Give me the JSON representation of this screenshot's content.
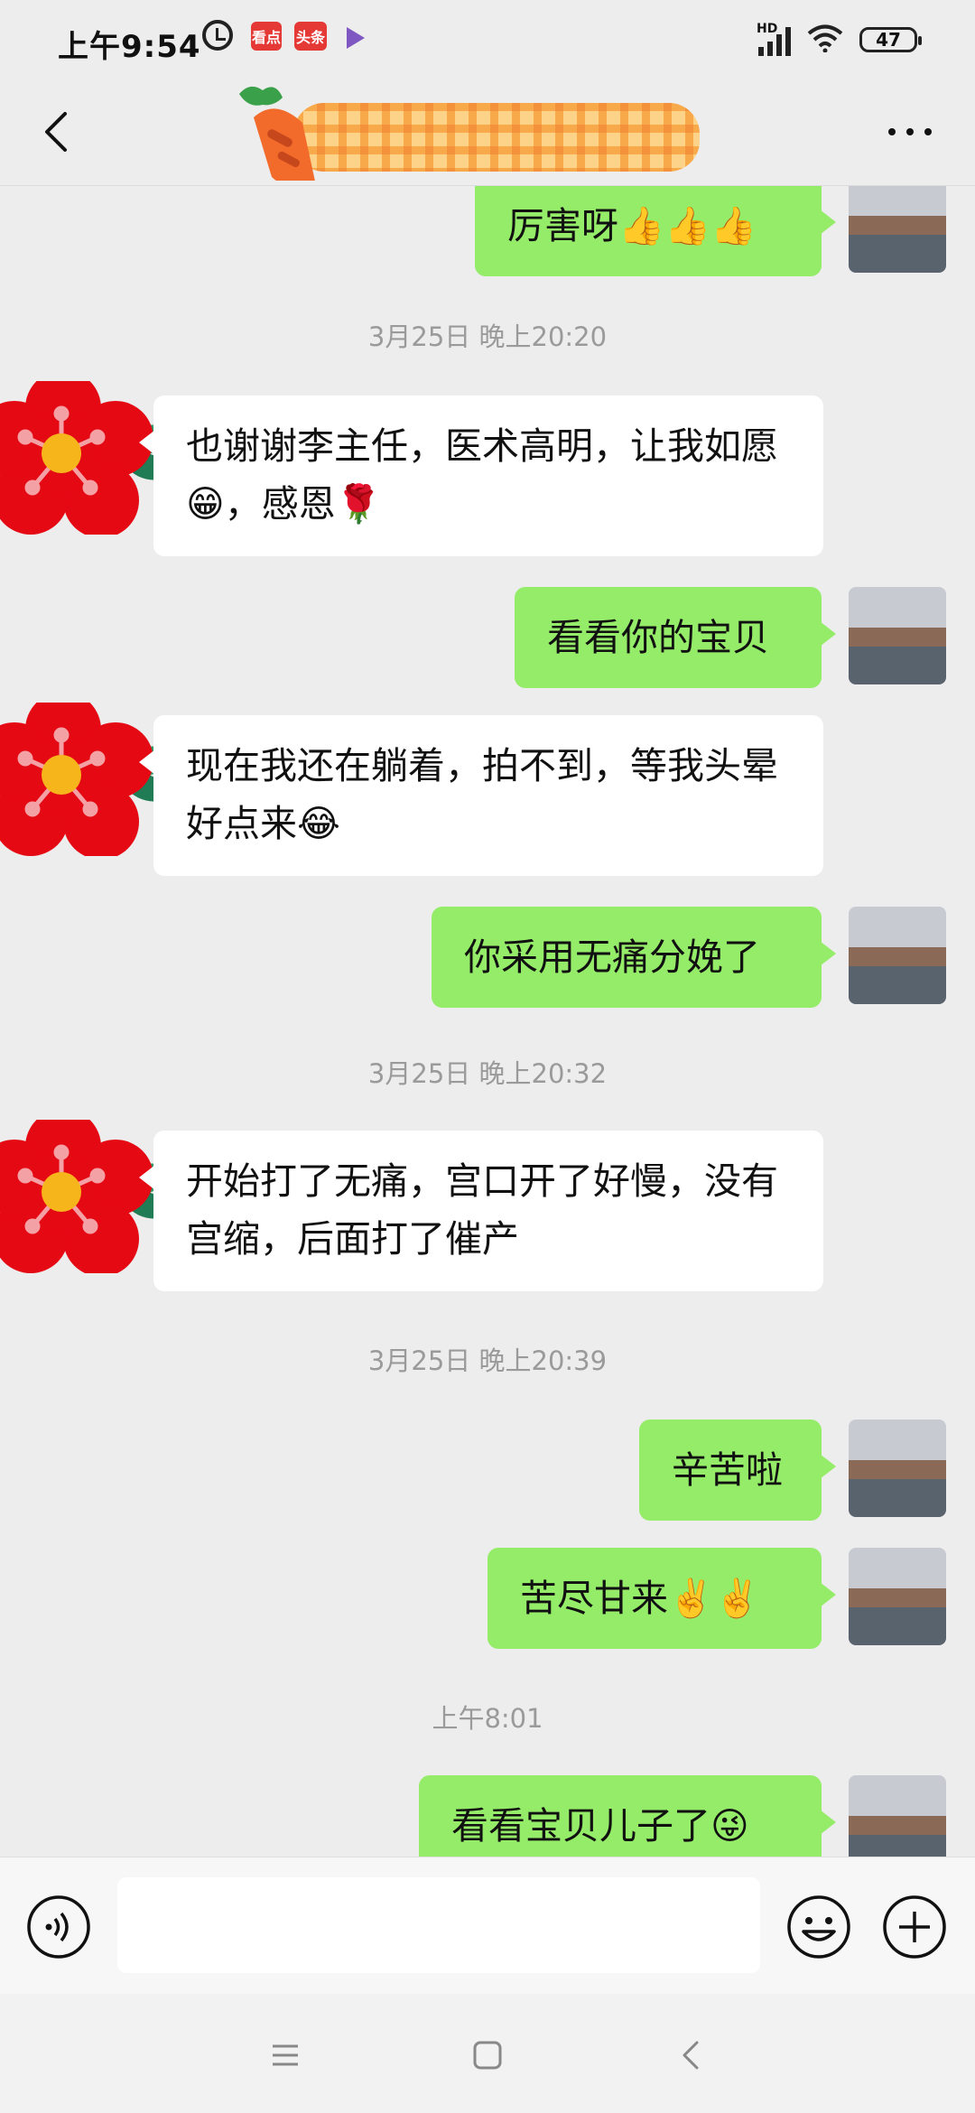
{
  "status_bar": {
    "time": "上午9:54",
    "badge_kandian": "看点",
    "badge_toutiao": "头条",
    "network": "HD",
    "battery": "47"
  },
  "header": {
    "back_icon": "back-arrow-icon",
    "more_icon": "more-dots-icon"
  },
  "messages": [
    {
      "type": "bubble",
      "side": "me",
      "text": "厉害呀👍👍👍"
    },
    {
      "type": "time",
      "text": "3月25日 晚上20:20"
    },
    {
      "type": "bubble",
      "side": "them",
      "text": "也谢谢李主任，医术高明，让我如愿😁，感恩🌹"
    },
    {
      "type": "bubble",
      "side": "me",
      "text": "看看你的宝贝"
    },
    {
      "type": "bubble",
      "side": "them",
      "text": "现在我还在躺着，拍不到，等我头晕好点来😂"
    },
    {
      "type": "bubble",
      "side": "me",
      "text": "你采用无痛分娩了"
    },
    {
      "type": "time",
      "text": "3月25日 晚上20:32"
    },
    {
      "type": "bubble",
      "side": "them",
      "text": "开始打了无痛，宫口开了好慢，没有宫缩，后面打了催产"
    },
    {
      "type": "time",
      "text": "3月25日 晚上20:39"
    },
    {
      "type": "bubble",
      "side": "me",
      "text": "辛苦啦"
    },
    {
      "type": "bubble",
      "side": "me",
      "text": "苦尽甘来✌️✌️"
    },
    {
      "type": "time",
      "text": "上午8:01"
    },
    {
      "type": "bubble",
      "side": "me",
      "text": "看看宝贝儿子了😜"
    }
  ],
  "input_bar": {
    "voice_icon": "voice-icon",
    "text_value": "",
    "emoji_icon": "emoji-icon",
    "plus_icon": "plus-icon"
  },
  "nav_bar": {
    "menu_icon": "menu-icon",
    "home_icon": "home-icon",
    "back_icon": "nav-back-icon"
  },
  "colors": {
    "background": "#ededed",
    "my_bubble": "#95ec69",
    "their_bubble": "#ffffff",
    "timestamp_text": "#9a9a9a"
  }
}
